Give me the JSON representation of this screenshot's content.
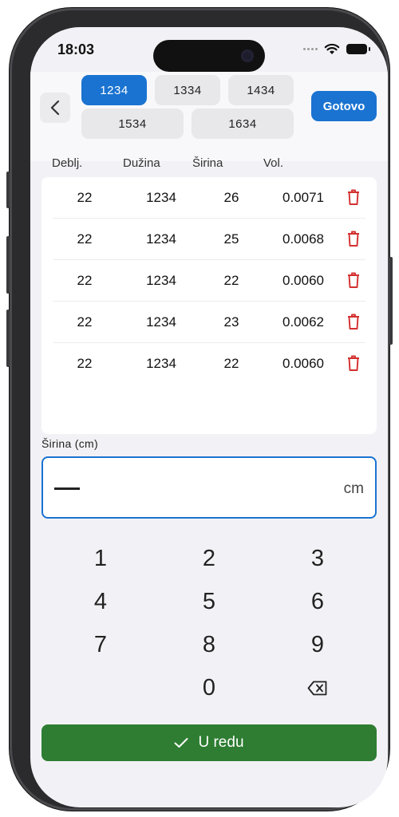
{
  "status": {
    "time": "18:03"
  },
  "header": {
    "tabs": [
      {
        "label": "1234",
        "active": true
      },
      {
        "label": "1334",
        "active": false
      },
      {
        "label": "1434",
        "active": false
      },
      {
        "label": "1534",
        "active": false
      },
      {
        "label": "1634",
        "active": false
      }
    ],
    "done_label": "Gotovo"
  },
  "table": {
    "columns": [
      "Deblj.",
      "Dužina",
      "Širina",
      "Vol."
    ],
    "rows": [
      {
        "deblj": "22",
        "duzina": "1234",
        "sirina": "26",
        "vol": "0.0071"
      },
      {
        "deblj": "22",
        "duzina": "1234",
        "sirina": "25",
        "vol": "0.0068"
      },
      {
        "deblj": "22",
        "duzina": "1234",
        "sirina": "22",
        "vol": "0.0060"
      },
      {
        "deblj": "22",
        "duzina": "1234",
        "sirina": "23",
        "vol": "0.0062"
      },
      {
        "deblj": "22",
        "duzina": "1234",
        "sirina": "22",
        "vol": "0.0060"
      }
    ]
  },
  "input": {
    "label": "Širina (cm)",
    "value": "",
    "unit": "cm"
  },
  "keypad": {
    "keys": [
      "1",
      "2",
      "3",
      "4",
      "5",
      "6",
      "7",
      "8",
      "9",
      "0"
    ]
  },
  "ok_button": {
    "label": "U redu"
  },
  "colors": {
    "accent": "#1a73d1",
    "confirm": "#2e7d32",
    "delete": "#d32f2f"
  },
  "icons": {
    "back": "chevron-left-icon",
    "delete": "trash-icon",
    "backspace": "backspace-icon",
    "confirm": "checkmark-icon"
  }
}
